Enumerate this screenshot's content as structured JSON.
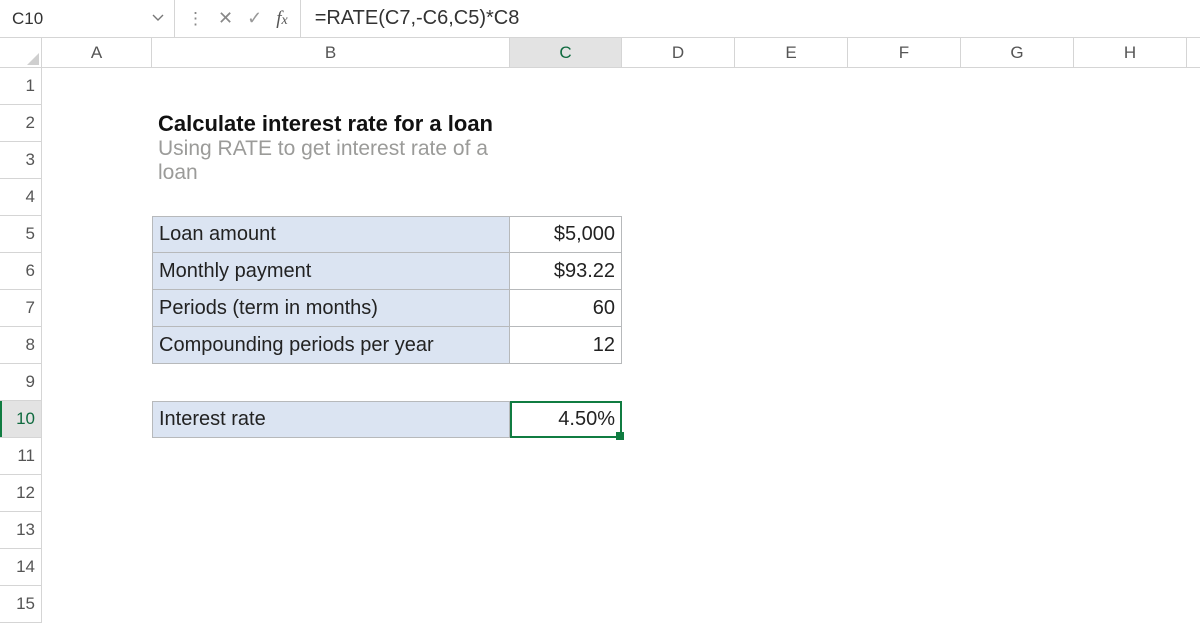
{
  "name_box": "C10",
  "formula": "=RATE(C7,-C6,C5)*C8",
  "columns": [
    "A",
    "B",
    "C",
    "D",
    "E",
    "F",
    "G",
    "H"
  ],
  "active_column": "C",
  "rows_shown": [
    1,
    2,
    3,
    4,
    5,
    6,
    7,
    8,
    9,
    10,
    11,
    12,
    13,
    14,
    15
  ],
  "active_row": 10,
  "title": "Calculate interest rate for a loan",
  "subtitle": "Using RATE to get interest rate of a loan",
  "table1": [
    {
      "label": "Loan amount",
      "value": "$5,000"
    },
    {
      "label": "Monthly payment",
      "value": "$93.22"
    },
    {
      "label": "Periods (term in months)",
      "value": "60"
    },
    {
      "label": "Compounding periods per year",
      "value": "12"
    }
  ],
  "result": {
    "label": "Interest rate",
    "value": "4.50%"
  },
  "chart_data": {
    "type": "table",
    "title": "Calculate interest rate for a loan",
    "rows": [
      {
        "label": "Loan amount",
        "value": 5000,
        "display": "$5,000"
      },
      {
        "label": "Monthly payment",
        "value": 93.22,
        "display": "$93.22"
      },
      {
        "label": "Periods (term in months)",
        "value": 60,
        "display": "60"
      },
      {
        "label": "Compounding periods per year",
        "value": 12,
        "display": "12"
      },
      {
        "label": "Interest rate",
        "value": 0.045,
        "display": "4.50%"
      }
    ],
    "formula": "=RATE(C7,-C6,C5)*C8"
  },
  "colors": {
    "selection_border": "#107c41",
    "label_fill": "#dbe4f2",
    "grid_line": "#d5d5d5"
  }
}
